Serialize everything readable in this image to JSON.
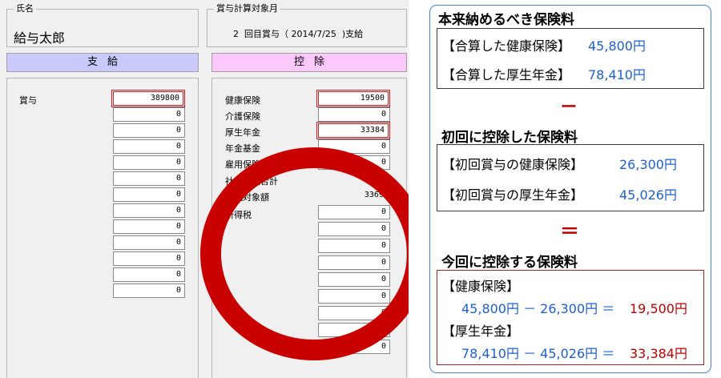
{
  "form": {
    "name_label": "氏名",
    "name_value": "給与太郎",
    "period_label": "賞与計算対象月",
    "period_value": "2  回目賞与（ 2014/7/25  )支給",
    "pay_header": "支給",
    "ded_header": "控除",
    "pay_rows": [
      {
        "label": "賞与",
        "value": "389800"
      },
      {
        "label": "",
        "value": "0"
      },
      {
        "label": "",
        "value": "0"
      },
      {
        "label": "",
        "value": "0"
      },
      {
        "label": "",
        "value": "0"
      },
      {
        "label": "",
        "value": "0"
      },
      {
        "label": "",
        "value": "0"
      },
      {
        "label": "",
        "value": "0"
      },
      {
        "label": "",
        "value": "0"
      },
      {
        "label": "",
        "value": "0"
      },
      {
        "label": "",
        "value": "0"
      },
      {
        "label": "",
        "value": "0"
      },
      {
        "label": "",
        "value": "0"
      }
    ],
    "ded_rows": [
      {
        "label": "健康保険",
        "value": "19500"
      },
      {
        "label": "介護保険",
        "value": "0"
      },
      {
        "label": "厚生年金",
        "value": "33384"
      },
      {
        "label": "年金基金",
        "value": "0"
      },
      {
        "label": "雇用保険",
        "value": "0"
      },
      {
        "label": "社会保険合計",
        "value": "0"
      },
      {
        "label": "課税対象額",
        "value": "33691"
      },
      {
        "label": "所得税",
        "value": "0"
      },
      {
        "label": "",
        "value": "0"
      },
      {
        "label": "",
        "value": "0"
      },
      {
        "label": "",
        "value": "0"
      },
      {
        "label": "",
        "value": "0"
      },
      {
        "label": "",
        "value": "0"
      },
      {
        "label": "",
        "value": "0"
      },
      {
        "label": "",
        "value": "0"
      },
      {
        "label": "",
        "value": "0"
      }
    ]
  },
  "explanation": {
    "sec1_title": "本来納めるべき保険料",
    "sec1_line1_label": "【合算した健康保険】",
    "sec1_line1_value": "45,800円",
    "sec1_line2_label": "【合算した厚生年金】",
    "sec1_line2_value": "78,410円",
    "minus_sign": "ー",
    "sec2_title": "初回に控除した保険料",
    "sec2_line1_label": "【初回賞与の健康保険】",
    "sec2_line1_value": "26,300円",
    "sec2_line2_label": "【初回賞与の厚生年金】",
    "sec2_line2_value": "45,026円",
    "equals_sign": "＝",
    "sec3_title": "今回に控除する保険料",
    "sec3_hi_label": "【健康保険】",
    "sec3_hi_expr": "45,800円 － 26,300円 ＝",
    "sec3_hi_result": "19,500円",
    "sec3_pe_label": "【厚生年金】",
    "sec3_pe_expr": "78,410円 － 45,026円 ＝",
    "sec3_pe_result": "33,384円"
  },
  "colors": {
    "pay_header_bg": "#c9c9fb",
    "ded_header_bg": "#fbc8fb",
    "highlight_red": "#c80000",
    "amount_blue": "#1f5fd0",
    "frame_blue": "#4a80c8"
  }
}
